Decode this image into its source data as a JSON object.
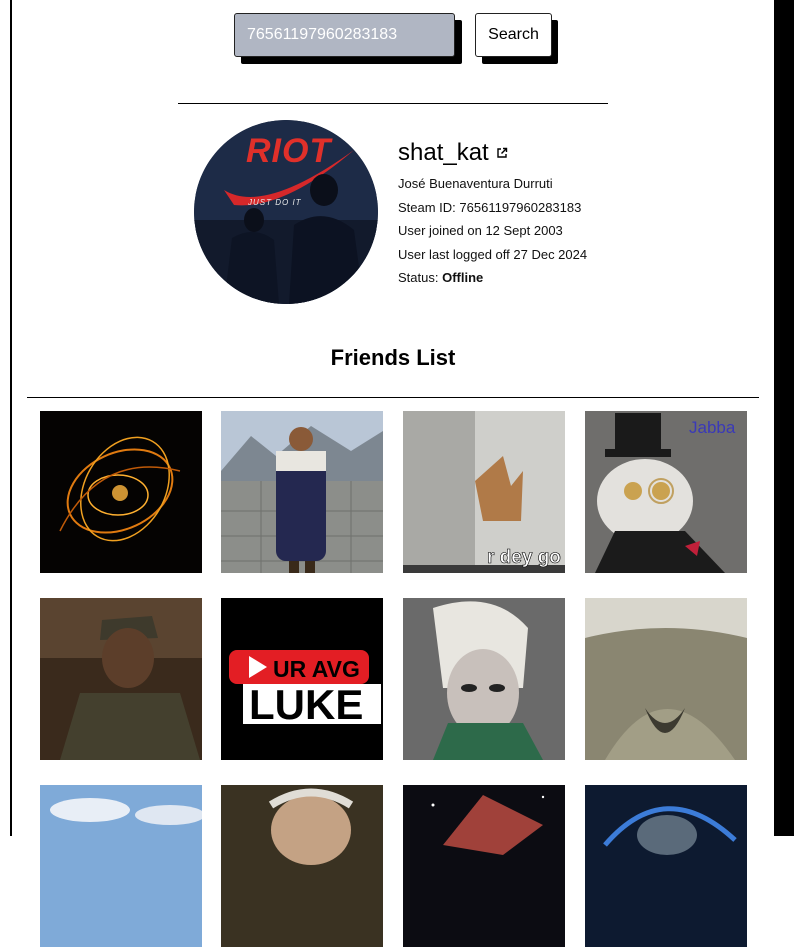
{
  "search": {
    "value": "76561197960283183",
    "button_label": "Search"
  },
  "profile": {
    "username": "shat_kat",
    "avatar_text_top": "RIOT",
    "avatar_text_bottom": "JUST DO IT",
    "real_name": "José Buenaventura Durruti",
    "steam_id_line": "Steam ID: 76561197960283183",
    "joined_line": "User joined on 12 Sept 2003",
    "logged_off_line": "User last logged off 27 Dec 2024",
    "status_label": "Status: ",
    "status_value": "Offline"
  },
  "friends": {
    "title": "Friends List",
    "tiles": [
      {
        "caption": ""
      },
      {
        "caption": ""
      },
      {
        "caption": "r dey go"
      },
      {
        "caption": "Jabba"
      },
      {
        "caption": ""
      },
      {
        "caption_top": "UR AVG",
        "caption_bottom": "LUKE"
      },
      {
        "caption": ""
      },
      {
        "caption": ""
      },
      {
        "caption": ""
      },
      {
        "caption": ""
      },
      {
        "caption": ""
      },
      {
        "caption": ""
      }
    ]
  }
}
